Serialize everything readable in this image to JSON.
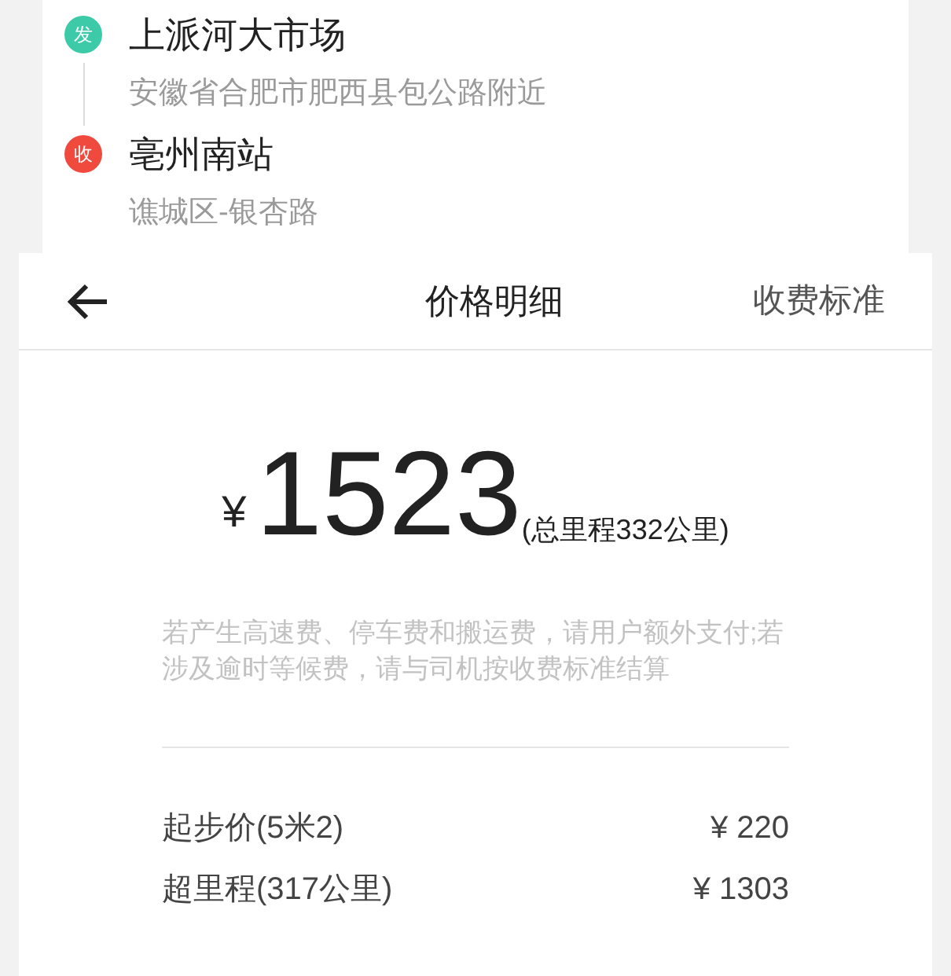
{
  "route": {
    "stops": [
      {
        "badge": "发",
        "kind": "start",
        "color": "#3ccaa9",
        "name": "上派河大市场",
        "address": "安徽省合肥市肥西县包公路附近"
      },
      {
        "badge": "收",
        "kind": "end",
        "color": "#f0493e",
        "name": "亳州南站",
        "address": "谯城区-银杏路"
      }
    ]
  },
  "header": {
    "title": "价格明细",
    "action": "收费标准"
  },
  "price": {
    "currency": "¥",
    "amount": "1523",
    "distance": "(总里程332公里)"
  },
  "note": "若产生高速费、停车费和搬运费，请用户额外支付;若涉及逾时等候费，请与司机按收费标准结算",
  "items": [
    {
      "label": "起步价(5米2)",
      "value": "¥ 220"
    },
    {
      "label": "超里程(317公里)",
      "value": "¥ 1303"
    }
  ]
}
